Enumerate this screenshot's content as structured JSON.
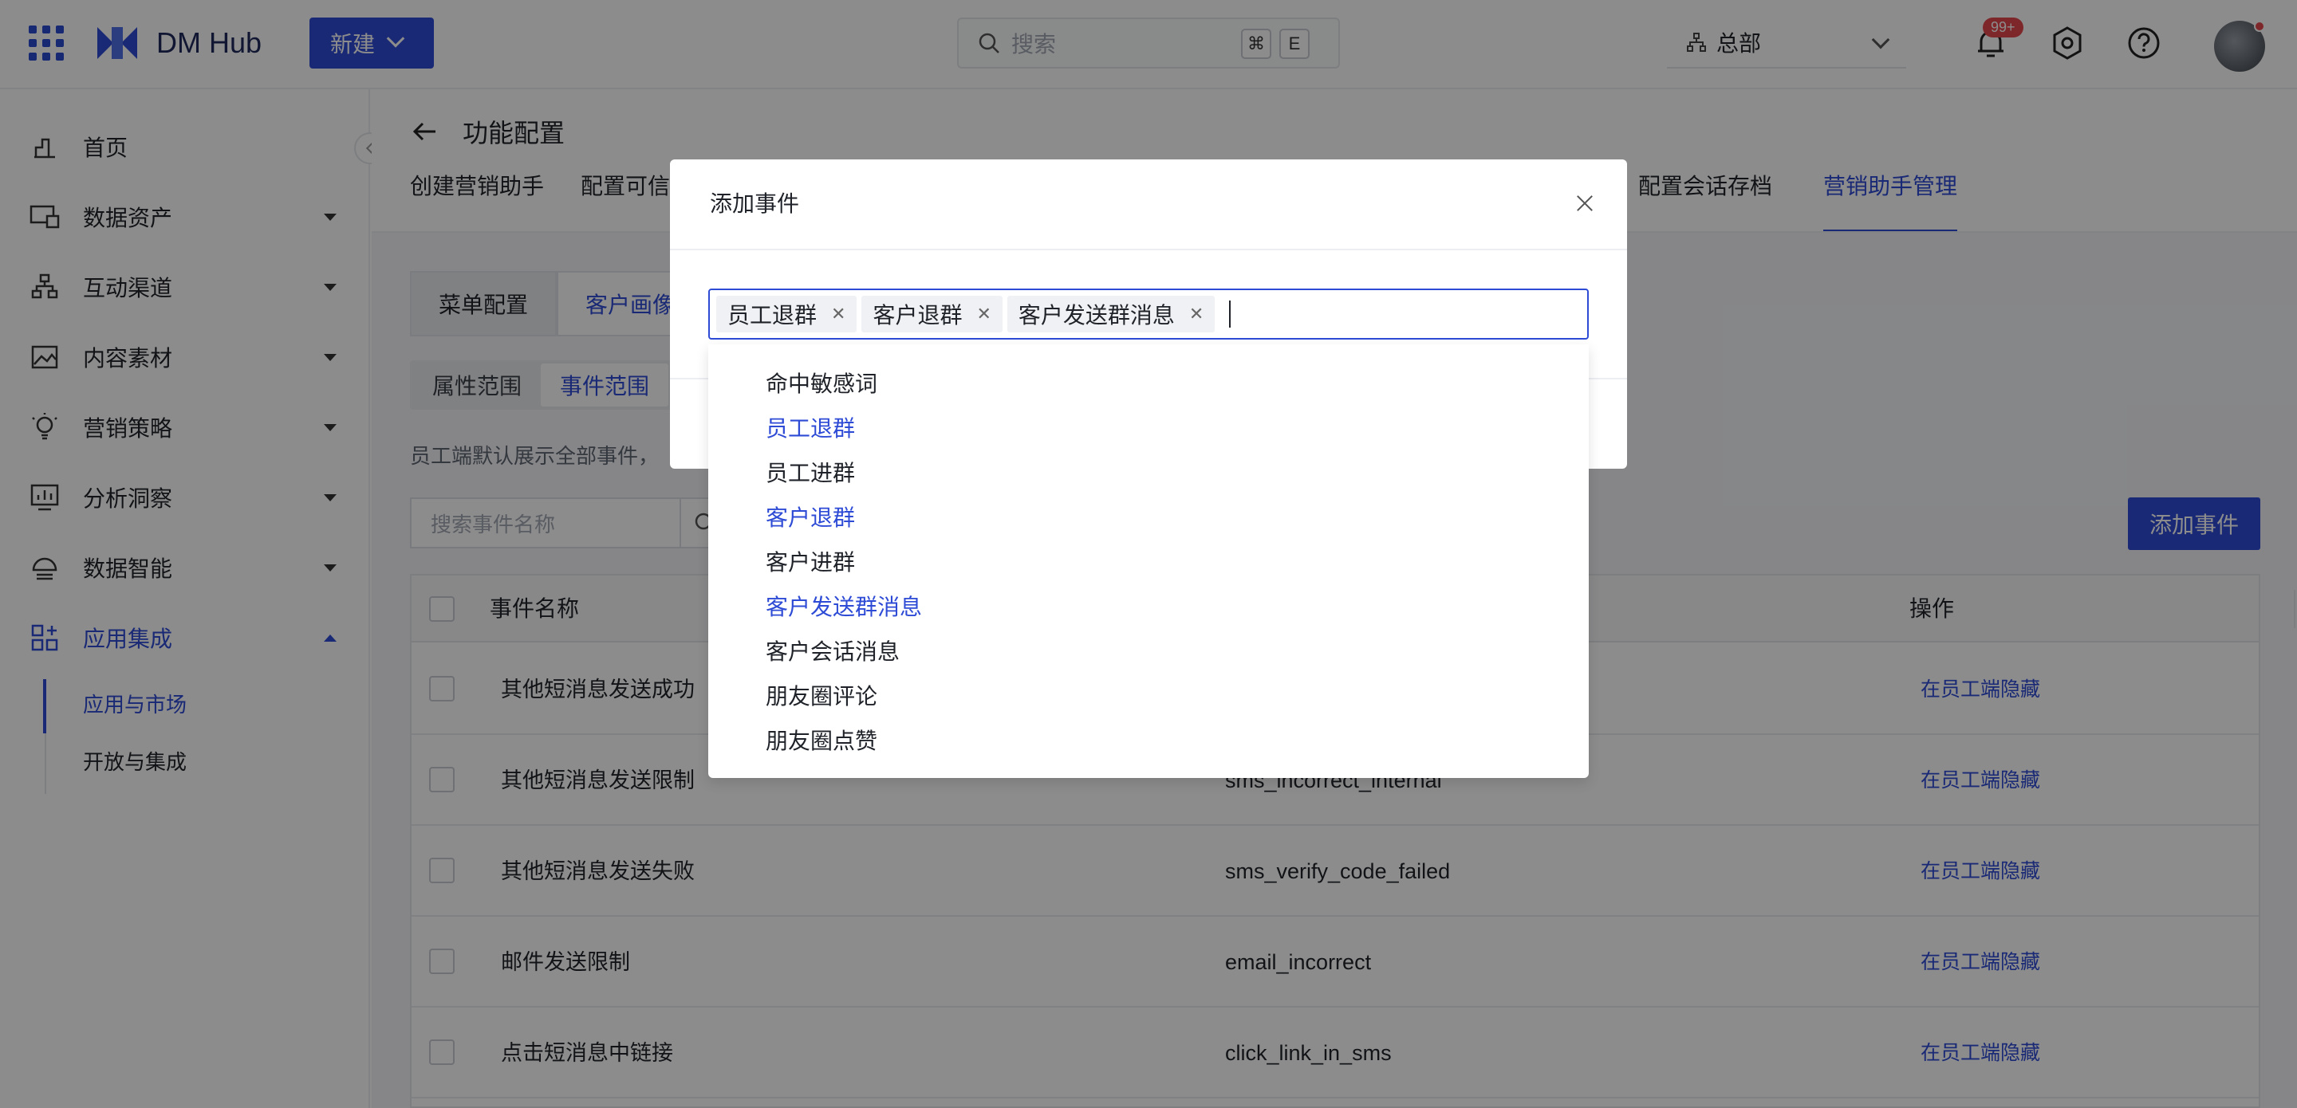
{
  "app": {
    "name": "DM Hub",
    "new_button": "新建",
    "search_placeholder": "搜索",
    "shortcut_keys": [
      "⌘",
      "E"
    ],
    "org": "总部",
    "notification_badge": "99+"
  },
  "sidebar": {
    "items": [
      {
        "label": "首页",
        "icon": "home-icon"
      },
      {
        "label": "数据资产",
        "icon": "data-assets-icon"
      },
      {
        "label": "互动渠道",
        "icon": "channels-icon"
      },
      {
        "label": "内容素材",
        "icon": "content-icon"
      },
      {
        "label": "营销策略",
        "icon": "strategy-icon"
      },
      {
        "label": "分析洞察",
        "icon": "analytics-icon"
      },
      {
        "label": "数据智能",
        "icon": "data-intel-icon"
      },
      {
        "label": "应用集成",
        "icon": "apps-icon"
      }
    ],
    "sub_items": [
      {
        "label": "应用与市场"
      },
      {
        "label": "开放与集成"
      }
    ]
  },
  "page": {
    "title": "功能配置",
    "tabs": [
      "创建营销助手",
      "配置可信",
      "配置会话存档",
      "营销助手管理"
    ],
    "segments": [
      "菜单配置",
      "客户画像"
    ],
    "subtabs": [
      "属性范围",
      "事件范围"
    ],
    "hint": "员工端默认展示全部事件，",
    "search_placeholder": "搜索事件名称",
    "add_event": "添加事件",
    "columns": {
      "name": "事件名称",
      "action": "操作"
    },
    "rows": [
      {
        "name": "其他短消息发送成功",
        "code": "",
        "action": "在员工端隐藏"
      },
      {
        "name": "其他短消息发送限制",
        "code": "sms_incorrect_internal",
        "action": "在员工端隐藏"
      },
      {
        "name": "其他短消息发送失败",
        "code": "sms_verify_code_failed",
        "action": "在员工端隐藏"
      },
      {
        "name": "邮件发送限制",
        "code": "email_incorrect",
        "action": "在员工端隐藏"
      },
      {
        "name": "点击短消息中链接",
        "code": "click_link_in_sms",
        "action": "在员工端隐藏"
      }
    ]
  },
  "modal": {
    "title": "添加事件",
    "tags": [
      "员工退群",
      "客户退群",
      "客户发送群消息"
    ],
    "options": [
      {
        "label": "命中敏感词",
        "selected": false
      },
      {
        "label": "员工退群",
        "selected": true
      },
      {
        "label": "员工进群",
        "selected": false
      },
      {
        "label": "客户退群",
        "selected": true
      },
      {
        "label": "客户进群",
        "selected": false
      },
      {
        "label": "客户发送群消息",
        "selected": true
      },
      {
        "label": "客户会话消息",
        "selected": false
      },
      {
        "label": "朋友圈评论",
        "selected": false
      },
      {
        "label": "朋友圈点赞",
        "selected": false
      }
    ]
  },
  "colors": {
    "accent": "#2e4bd6",
    "overlay": "rgba(0,0,0,0.45)"
  }
}
